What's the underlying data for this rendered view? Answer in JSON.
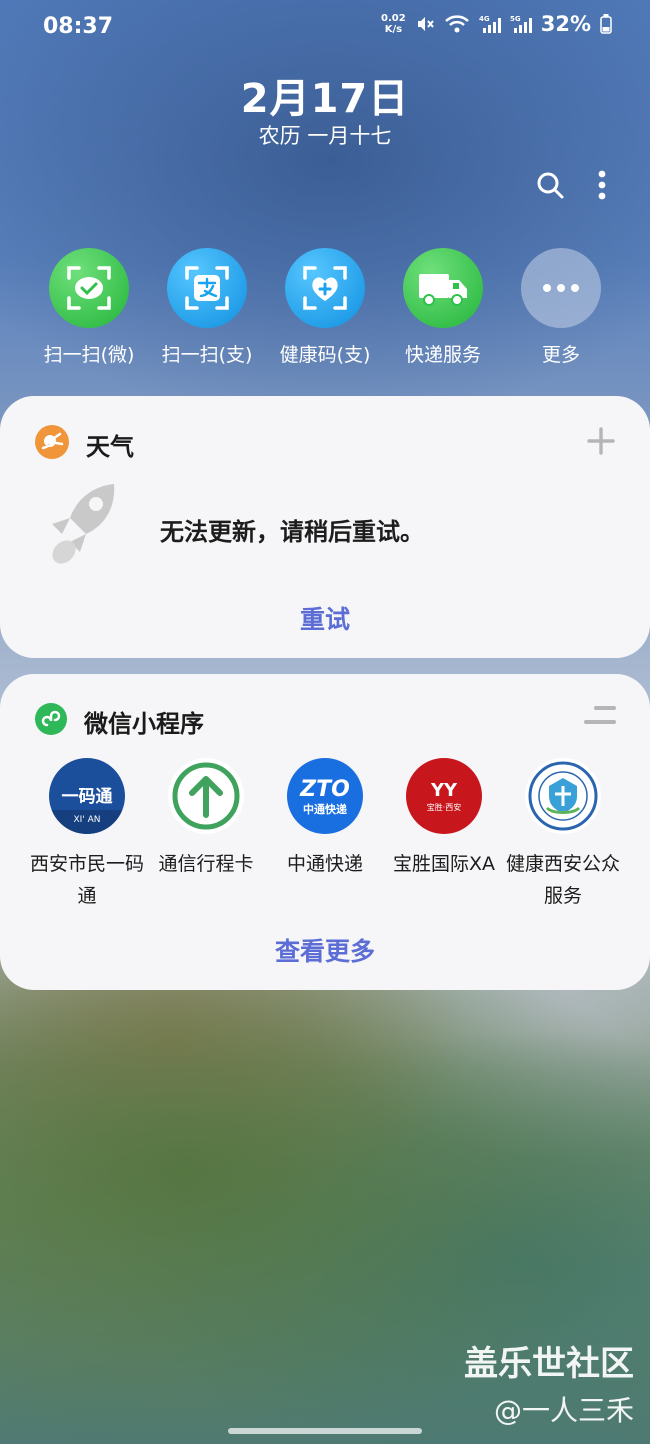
{
  "status_bar": {
    "time": "08:37",
    "net_speed_value": "0.02",
    "net_speed_unit": "K/s",
    "battery": "32%"
  },
  "date": "2月17日",
  "lunar_date": "农历 一月十七",
  "shortcuts": [
    {
      "label": "扫一扫(微)",
      "icon": "wechat-scan-icon",
      "color": "#2fc24a"
    },
    {
      "label": "扫一扫(支)",
      "icon": "alipay-scan-icon",
      "color": "#1aa3ee"
    },
    {
      "label": "健康码(支)",
      "icon": "health-code-icon",
      "color": "#1aa3ee"
    },
    {
      "label": "快递服务",
      "icon": "delivery-truck-icon",
      "color": "#2fc24a"
    },
    {
      "label": "更多",
      "icon": "more-dots-icon",
      "color": "#a8bad6"
    }
  ],
  "weather_card": {
    "title": "天气",
    "message": "无法更新，请稍后重试。",
    "retry_label": "重试"
  },
  "mini_programs_card": {
    "title": "微信小程序",
    "apps": [
      {
        "name": "西安市民一码通",
        "logo_text": "一码通",
        "sub_text": "XI' AN"
      },
      {
        "name": "通信行程卡"
      },
      {
        "name": "中通快递",
        "logo_text": "ZTO",
        "sub_text": "中通快递"
      },
      {
        "name": "宝胜国际XA",
        "logo_text": "YY",
        "sub_text": "宝胜·西安"
      },
      {
        "name": "健康西安公众服务"
      }
    ],
    "see_more_label": "查看更多"
  },
  "watermark": {
    "line1": "盖乐世社区",
    "line2": "@一人三禾"
  },
  "colors": {
    "accent": "#5c6ed6",
    "card_bg": "#f6f6f8"
  }
}
